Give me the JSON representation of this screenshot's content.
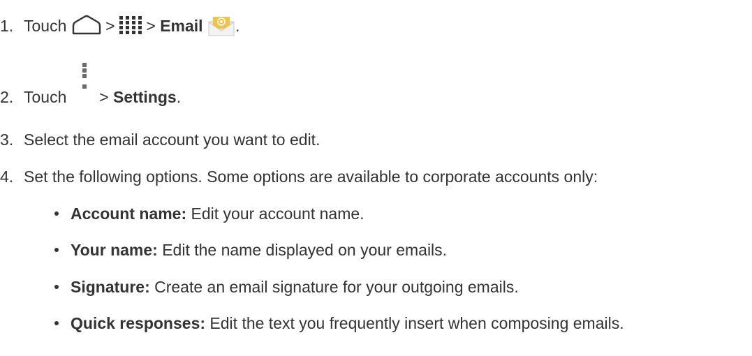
{
  "steps": [
    {
      "number": "1.",
      "pre": "Touch",
      "sep1": ">",
      "sep2": ">",
      "bold": "Email",
      "post": "."
    },
    {
      "number": "2.",
      "pre": "Touch",
      "sep": ">",
      "bold": "Settings",
      "post": "."
    },
    {
      "number": "3.",
      "text": "Select the email account you want to edit."
    },
    {
      "number": "4.",
      "text": "Set the following options. Some options are available to corporate accounts only:"
    }
  ],
  "options": [
    {
      "term": "Account name:",
      "desc": " Edit your account name."
    },
    {
      "term": "Your name:",
      "desc": " Edit the name displayed on your emails."
    },
    {
      "term": "Signature:",
      "desc": " Create an email signature for your outgoing emails."
    },
    {
      "term": "Quick responses:",
      "desc": " Edit the text you frequently insert when composing emails."
    }
  ],
  "icons": [
    "home-icon",
    "apps-icon",
    "email-app-icon",
    "menu-icon"
  ],
  "colors": {
    "text": "#333333",
    "envelope": "#f1c24a"
  }
}
